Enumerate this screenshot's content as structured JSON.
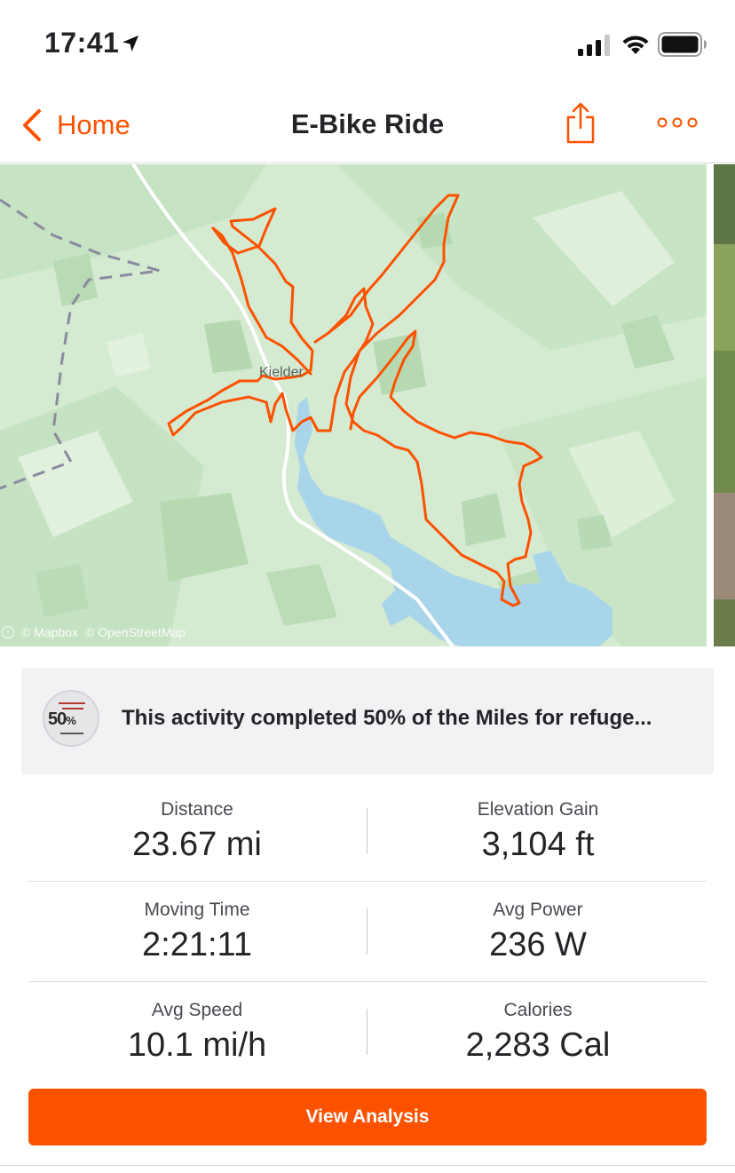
{
  "status_bar": {
    "time": "17:41"
  },
  "nav": {
    "back_label": "Home",
    "title": "E-Bike Ride",
    "accent_color": "#fc5200"
  },
  "map": {
    "place_label": "Kielder",
    "attribution_mapbox": "© Mapbox",
    "attribution_osm": "© OpenStreetMap",
    "route_color": "#fc5200",
    "water_color": "#a9d5ea"
  },
  "challenge": {
    "badge_percent": "50",
    "badge_percent_sign": "%",
    "text": "This activity completed 50% of the Miles for refuge..."
  },
  "stats": [
    {
      "label": "Distance",
      "value": "23.67 mi"
    },
    {
      "label": "Elevation Gain",
      "value": "3,104 ft"
    },
    {
      "label": "Moving Time",
      "value": "2:21:11"
    },
    {
      "label": "Avg Power",
      "value": "236 W"
    },
    {
      "label": "Avg Speed",
      "value": "10.1 mi/h"
    },
    {
      "label": "Calories",
      "value": "2,283 Cal"
    }
  ],
  "actions": {
    "view_analysis_label": "View Analysis"
  }
}
